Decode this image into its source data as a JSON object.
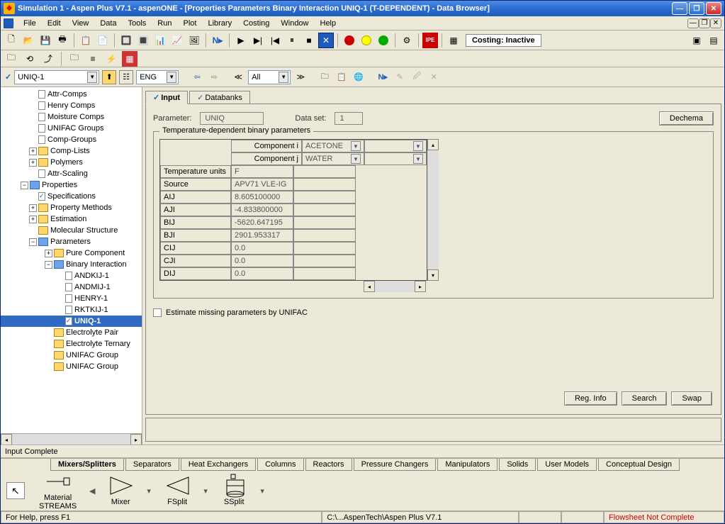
{
  "window": {
    "title": "Simulation 1 - Aspen Plus V7.1 - aspenONE - [Properties Parameters Binary Interaction UNIQ-1 (T-DEPENDENT) - Data Browser]"
  },
  "menu": [
    "File",
    "Edit",
    "View",
    "Data",
    "Tools",
    "Run",
    "Plot",
    "Library",
    "Costing",
    "Window",
    "Help"
  ],
  "costing_status": "Costing: Inactive",
  "nav": {
    "object": "UNIQ-1",
    "units": "ENG",
    "scope": "All"
  },
  "tree": [
    {
      "lvl": 1,
      "label": "Attr-Comps",
      "icon": "leaf"
    },
    {
      "lvl": 1,
      "label": "Henry Comps",
      "icon": "leaf"
    },
    {
      "lvl": 1,
      "label": "Moisture Comps",
      "icon": "leaf"
    },
    {
      "lvl": 1,
      "label": "UNIFAC Groups",
      "icon": "leaf"
    },
    {
      "lvl": 1,
      "label": "Comp-Groups",
      "icon": "leaf"
    },
    {
      "lvl": 1,
      "label": "Comp-Lists",
      "icon": "folder",
      "exp": "+"
    },
    {
      "lvl": 1,
      "label": "Polymers",
      "icon": "folder",
      "exp": "+"
    },
    {
      "lvl": 1,
      "label": "Attr-Scaling",
      "icon": "leaf"
    },
    {
      "lvl": 0,
      "label": "Properties",
      "icon": "folder-blue",
      "exp": "−"
    },
    {
      "lvl": 1,
      "label": "Specifications",
      "icon": "leaf-check"
    },
    {
      "lvl": 1,
      "label": "Property Methods",
      "icon": "folder",
      "exp": "+"
    },
    {
      "lvl": 1,
      "label": "Estimation",
      "icon": "folder",
      "exp": "+"
    },
    {
      "lvl": 1,
      "label": "Molecular Structure",
      "icon": "folder"
    },
    {
      "lvl": 1,
      "label": "Parameters",
      "icon": "folder-blue",
      "exp": "−"
    },
    {
      "lvl": 2,
      "label": "Pure Component",
      "icon": "folder",
      "exp": "+"
    },
    {
      "lvl": 2,
      "label": "Binary Interaction",
      "icon": "folder-blue",
      "exp": "−"
    },
    {
      "lvl": 3,
      "label": "ANDKIJ-1",
      "icon": "leaf"
    },
    {
      "lvl": 3,
      "label": "ANDMIJ-1",
      "icon": "leaf"
    },
    {
      "lvl": 3,
      "label": "HENRY-1",
      "icon": "leaf"
    },
    {
      "lvl": 3,
      "label": "RKTKIJ-1",
      "icon": "leaf"
    },
    {
      "lvl": 3,
      "label": "UNIQ-1",
      "icon": "leaf-check",
      "sel": true,
      "bold": true
    },
    {
      "lvl": 2,
      "label": "Electrolyte Pair",
      "icon": "folder"
    },
    {
      "lvl": 2,
      "label": "Electrolyte Ternary",
      "icon": "folder"
    },
    {
      "lvl": 2,
      "label": "UNIFAC Group",
      "icon": "folder"
    },
    {
      "lvl": 2,
      "label": "UNIFAC Group",
      "icon": "folder"
    }
  ],
  "tabs": [
    "Input",
    "Databanks"
  ],
  "form": {
    "parameter_label": "Parameter:",
    "parameter_value": "UNIQ",
    "dataset_label": "Data set:",
    "dataset_value": "1",
    "dechema": "Dechema",
    "groupbox": "Temperature-dependent binary parameters",
    "comp_i_label": "Component i",
    "comp_j_label": "Component j",
    "comp_i_value": "ACETONE",
    "comp_j_value": "WATER",
    "rows": [
      {
        "k": "Temperature units",
        "v": "F"
      },
      {
        "k": "Source",
        "v": "APV71 VLE-IG"
      },
      {
        "k": "AIJ",
        "v": "8.605100000"
      },
      {
        "k": "AJI",
        "v": "-4.833800000"
      },
      {
        "k": "BIJ",
        "v": "-5620.647195"
      },
      {
        "k": "BJI",
        "v": "2901.953317"
      },
      {
        "k": "CIJ",
        "v": "0.0"
      },
      {
        "k": "CJI",
        "v": "0.0"
      },
      {
        "k": "DIJ",
        "v": "0.0"
      }
    ],
    "estimate_label": "Estimate missing parameters by UNIFAC",
    "btn_reginfo": "Reg. Info",
    "btn_search": "Search",
    "btn_swap": "Swap"
  },
  "status_mid": "Input Complete",
  "palette": {
    "tabs": [
      "Mixers/Splitters",
      "Separators",
      "Heat Exchangers",
      "Columns",
      "Reactors",
      "Pressure Changers",
      "Manipulators",
      "Solids",
      "User Models",
      "Conceptual Design"
    ],
    "items": [
      {
        "label": "Material\nSTREAMS"
      },
      {
        "label": "Mixer"
      },
      {
        "label": "FSplit"
      },
      {
        "label": "SSplit"
      }
    ]
  },
  "statusbar": {
    "help": "For Help, press F1",
    "path": "C:\\...AspenTech\\Aspen Plus V7.1",
    "flow": "Flowsheet Not Complete"
  }
}
